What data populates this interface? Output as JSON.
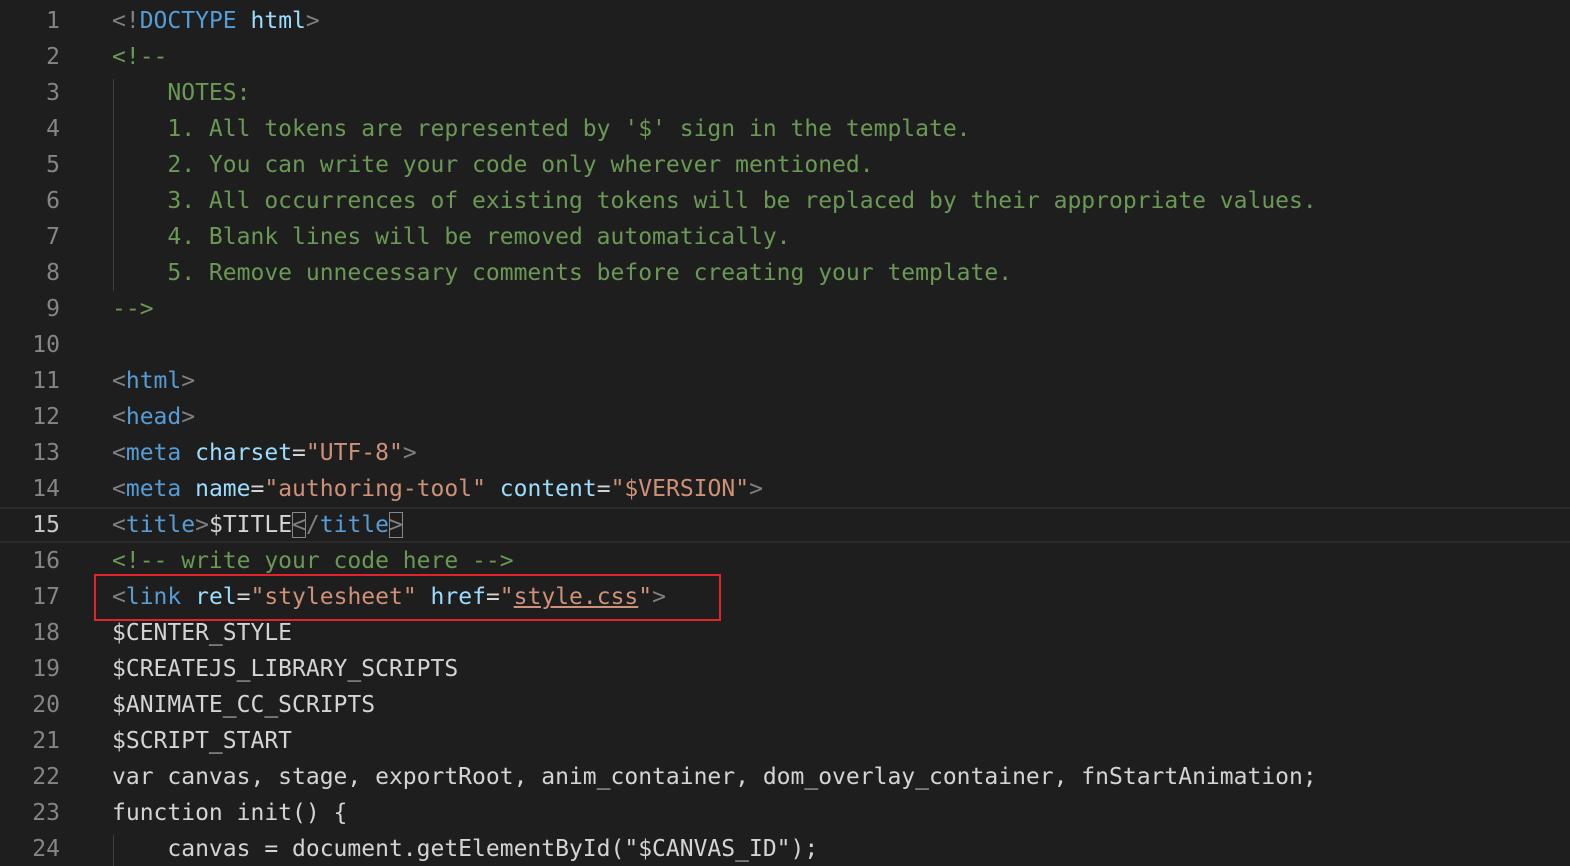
{
  "editor": {
    "lines": [
      {
        "num": "1",
        "tokens": [
          {
            "t": "<!",
            "c": "punct"
          },
          {
            "t": "DOCTYPE",
            "c": "tag"
          },
          {
            "t": " ",
            "c": "plain"
          },
          {
            "t": "html",
            "c": "attr"
          },
          {
            "t": ">",
            "c": "punct"
          }
        ]
      },
      {
        "num": "2",
        "tokens": [
          {
            "t": "<!--",
            "c": "comment"
          }
        ]
      },
      {
        "num": "3",
        "tokens": [
          {
            "t": "    NOTES:",
            "c": "comment"
          }
        ]
      },
      {
        "num": "4",
        "tokens": [
          {
            "t": "    1. All tokens are represented by '$' sign in the template.",
            "c": "comment"
          }
        ]
      },
      {
        "num": "5",
        "tokens": [
          {
            "t": "    2. You can write your code only wherever mentioned.",
            "c": "comment"
          }
        ]
      },
      {
        "num": "6",
        "tokens": [
          {
            "t": "    3. All occurrences of existing tokens will be replaced by their appropriate values.",
            "c": "comment"
          }
        ]
      },
      {
        "num": "7",
        "tokens": [
          {
            "t": "    4. Blank lines will be removed automatically.",
            "c": "comment"
          }
        ]
      },
      {
        "num": "8",
        "tokens": [
          {
            "t": "    5. Remove unnecessary comments before creating your template.",
            "c": "comment"
          }
        ]
      },
      {
        "num": "9",
        "tokens": [
          {
            "t": "-->",
            "c": "comment"
          }
        ]
      },
      {
        "num": "10",
        "tokens": []
      },
      {
        "num": "11",
        "tokens": [
          {
            "t": "<",
            "c": "punct"
          },
          {
            "t": "html",
            "c": "tag"
          },
          {
            "t": ">",
            "c": "punct"
          }
        ]
      },
      {
        "num": "12",
        "tokens": [
          {
            "t": "<",
            "c": "punct"
          },
          {
            "t": "head",
            "c": "tag"
          },
          {
            "t": ">",
            "c": "punct"
          }
        ]
      },
      {
        "num": "13",
        "tokens": [
          {
            "t": "<",
            "c": "punct"
          },
          {
            "t": "meta",
            "c": "tag"
          },
          {
            "t": " ",
            "c": "plain"
          },
          {
            "t": "charset",
            "c": "attr"
          },
          {
            "t": "=",
            "c": "plain"
          },
          {
            "t": "\"UTF-8\"",
            "c": "str"
          },
          {
            "t": ">",
            "c": "punct"
          }
        ]
      },
      {
        "num": "14",
        "tokens": [
          {
            "t": "<",
            "c": "punct"
          },
          {
            "t": "meta",
            "c": "tag"
          },
          {
            "t": " ",
            "c": "plain"
          },
          {
            "t": "name",
            "c": "attr"
          },
          {
            "t": "=",
            "c": "plain"
          },
          {
            "t": "\"authoring-tool\"",
            "c": "str"
          },
          {
            "t": " ",
            "c": "plain"
          },
          {
            "t": "content",
            "c": "attr"
          },
          {
            "t": "=",
            "c": "plain"
          },
          {
            "t": "\"$VERSION\"",
            "c": "str"
          },
          {
            "t": ">",
            "c": "punct"
          }
        ]
      },
      {
        "num": "15",
        "current": true,
        "tokens": [
          {
            "t": "<",
            "c": "punct"
          },
          {
            "t": "title",
            "c": "tag"
          },
          {
            "t": ">",
            "c": "punct"
          },
          {
            "t": "$TITLE",
            "c": "plain"
          },
          {
            "t": "<",
            "c": "punct",
            "match": true
          },
          {
            "t": "/",
            "c": "punct"
          },
          {
            "t": "title",
            "c": "tag"
          },
          {
            "t": ">",
            "c": "punct",
            "match": true
          }
        ]
      },
      {
        "num": "16",
        "tokens": [
          {
            "t": "<!-- write your code here -->",
            "c": "comment"
          }
        ]
      },
      {
        "num": "17",
        "tokens": [
          {
            "t": "<",
            "c": "punct"
          },
          {
            "t": "link",
            "c": "tag"
          },
          {
            "t": " ",
            "c": "plain"
          },
          {
            "t": "rel",
            "c": "attr"
          },
          {
            "t": "=",
            "c": "plain"
          },
          {
            "t": "\"stylesheet\"",
            "c": "str"
          },
          {
            "t": " ",
            "c": "plain"
          },
          {
            "t": "href",
            "c": "attr"
          },
          {
            "t": "=",
            "c": "plain"
          },
          {
            "t": "\"",
            "c": "str"
          },
          {
            "t": "style.css",
            "c": "str",
            "link": true
          },
          {
            "t": "\"",
            "c": "str"
          },
          {
            "t": ">",
            "c": "punct"
          }
        ]
      },
      {
        "num": "18",
        "tokens": [
          {
            "t": "$CENTER_STYLE",
            "c": "plain"
          }
        ]
      },
      {
        "num": "19",
        "tokens": [
          {
            "t": "$CREATEJS_LIBRARY_SCRIPTS",
            "c": "plain"
          }
        ]
      },
      {
        "num": "20",
        "tokens": [
          {
            "t": "$ANIMATE_CC_SCRIPTS",
            "c": "plain"
          }
        ]
      },
      {
        "num": "21",
        "tokens": [
          {
            "t": "$SCRIPT_START",
            "c": "plain"
          }
        ]
      },
      {
        "num": "22",
        "tokens": [
          {
            "t": "var canvas, stage, exportRoot, anim_container, dom_overlay_container, fnStartAnimation;",
            "c": "plain"
          }
        ]
      },
      {
        "num": "23",
        "tokens": [
          {
            "t": "function init() {",
            "c": "plain"
          }
        ]
      },
      {
        "num": "24",
        "tokens": [
          {
            "t": "    canvas = document.getElementById(\"$CANVAS_ID\");",
            "c": "plain"
          }
        ]
      }
    ]
  },
  "colors": {
    "background": "#1e1e1e",
    "line_number": "#858585",
    "comment": "#6a9955",
    "tag": "#569cd6",
    "attribute": "#9cdcfe",
    "string": "#ce9178",
    "punctuation": "#808080",
    "text": "#d4d4d4",
    "annotation_box": "#e0242a"
  },
  "annotation": {
    "highlighted_line": "17"
  }
}
